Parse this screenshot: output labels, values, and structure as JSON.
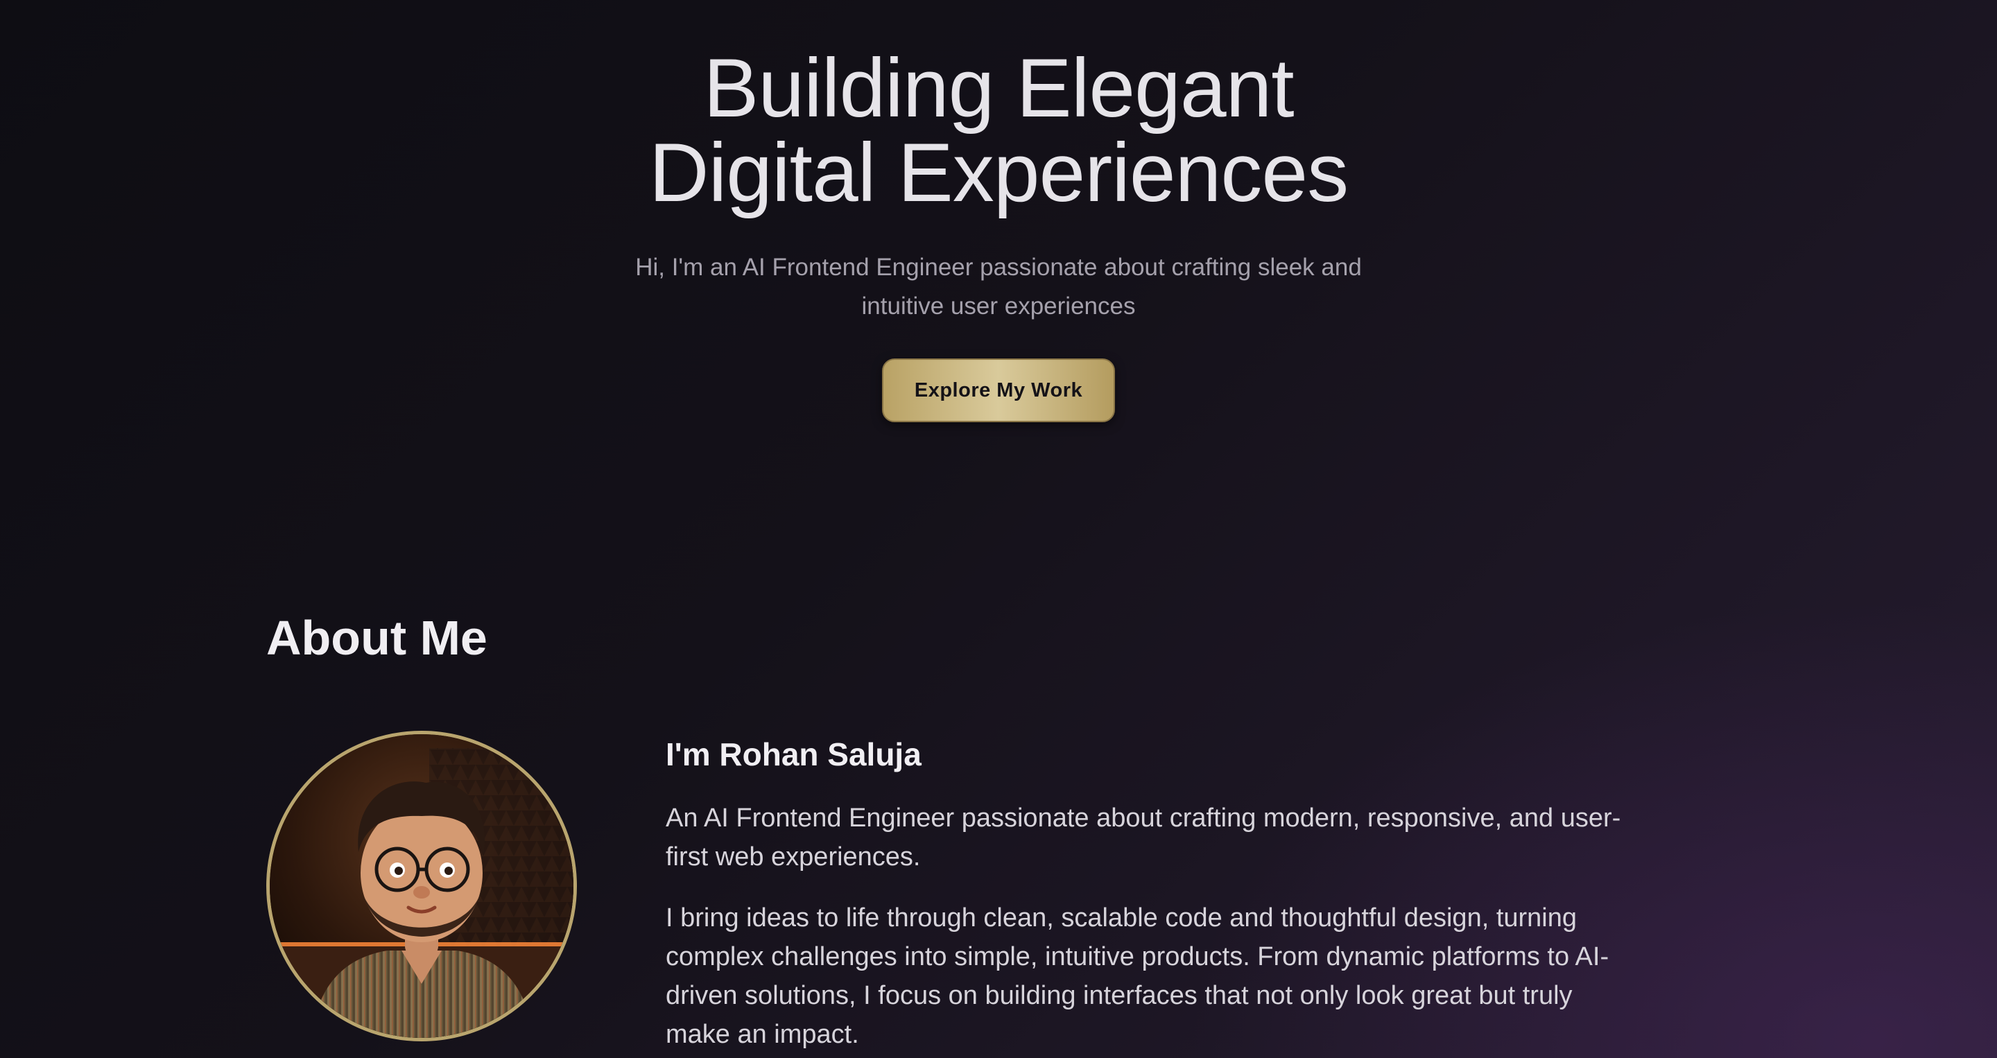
{
  "hero": {
    "title_line1": "Building Elegant",
    "title_line2": "Digital Experiences",
    "subtitle": "Hi, I'm an AI Frontend Engineer passionate about crafting sleek and intuitive user experiences",
    "cta_label": "Explore My Work"
  },
  "about": {
    "heading": "About Me",
    "name": "I'm Rohan Saluja",
    "paragraph1": "An AI Frontend Engineer passionate about crafting modern, responsive, and user-first web experiences.",
    "paragraph2": "I bring ideas to life through clean, scalable code and thoughtful design, turning complex challenges into simple, intuitive products. From dynamic platforms to AI-driven solutions, I focus on building interfaces that not only look great but truly make an impact.",
    "avatar_icon": "avatar-illustration"
  },
  "colors": {
    "accent_gold": "#c9b57f",
    "background_dark": "#0e0d13",
    "background_purple": "#2a1d36"
  }
}
